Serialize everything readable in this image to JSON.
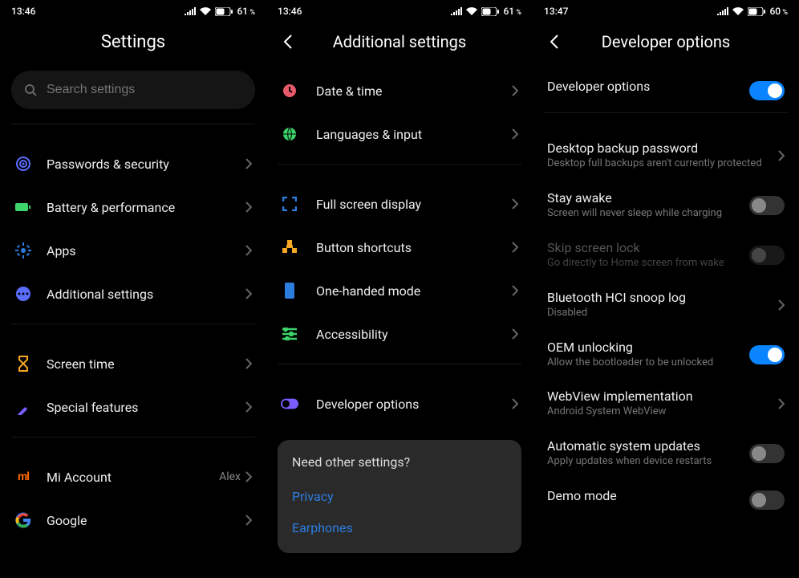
{
  "status": {
    "time_a": "13:46",
    "time_b": "13:46",
    "time_c": "13:47",
    "batt_a": "61",
    "batt_b": "61",
    "batt_c": "60",
    "pct": "%"
  },
  "s1": {
    "title": "Settings",
    "search_ph": "Search settings",
    "rows": {
      "pw": "Passwords & security",
      "bp": "Battery & performance",
      "apps": "Apps",
      "add": "Additional settings",
      "st": "Screen time",
      "sf": "Special features",
      "mi": "Mi Account",
      "mi_val": "Alex",
      "google": "Google"
    }
  },
  "s2": {
    "title": "Additional settings",
    "rows": {
      "dt": "Date & time",
      "lang": "Languages & input",
      "fs": "Full screen display",
      "btn": "Button shortcuts",
      "one": "One-handed mode",
      "acc": "Accessibility",
      "dev": "Developer options"
    },
    "need": {
      "q": "Need other settings?",
      "privacy": "Privacy",
      "ear": "Earphones"
    }
  },
  "s3": {
    "title": "Developer options",
    "rows": {
      "devopt": {
        "t": "Developer options"
      },
      "dbk": {
        "t": "Desktop backup password",
        "s": "Desktop full backups aren't currently protected"
      },
      "stay": {
        "t": "Stay awake",
        "s": "Screen will never sleep while charging"
      },
      "skip": {
        "t": "Skip screen lock",
        "s": "Go directly to Home screen from wake"
      },
      "bt": {
        "t": "Bluetooth HCI snoop log",
        "s": "Disabled"
      },
      "oem": {
        "t": "OEM unlocking",
        "s": "Allow the bootloader to be unlocked"
      },
      "wv": {
        "t": "WebView implementation",
        "s": "Android System WebView"
      },
      "auto": {
        "t": "Automatic system updates",
        "s": "Apply updates when device restarts"
      },
      "demo": {
        "t": "Demo mode"
      }
    }
  }
}
